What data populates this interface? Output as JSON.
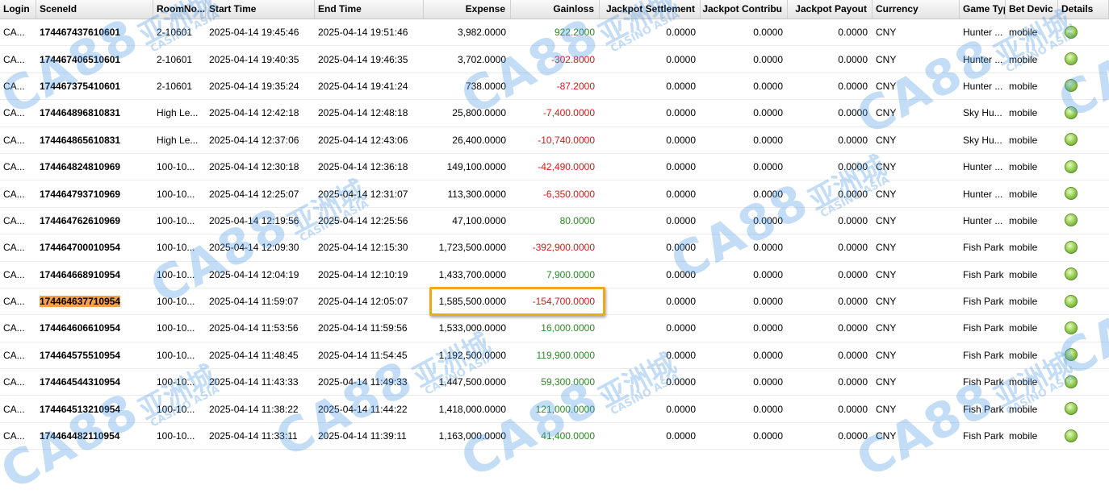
{
  "columns": [
    "Login",
    "SceneId",
    "RoomNo...",
    "Start Time",
    "End Time",
    "Expense",
    "Gainloss",
    "Jackpot Settlement",
    "Jackpot Contribu",
    "Jackpot Payout",
    "Currency",
    "Game Typ",
    "Bet Devic",
    "Details"
  ],
  "rows": [
    {
      "login": "CA...",
      "scene": "174467437610601",
      "room": "2-10601",
      "start": "2025-04-14 19:45:46",
      "end": "2025-04-14 19:51:46",
      "expense": "3,982.0000",
      "gainloss": "922.2000",
      "sign": "pos",
      "js": "0.0000",
      "jc": "0.0000",
      "jp": "0.0000",
      "currency": "CNY",
      "game": "Hunter ...",
      "device": "mobile"
    },
    {
      "login": "CA...",
      "scene": "174467406510601",
      "room": "2-10601",
      "start": "2025-04-14 19:40:35",
      "end": "2025-04-14 19:46:35",
      "expense": "3,702.0000",
      "gainloss": "-302.8000",
      "sign": "neg",
      "js": "0.0000",
      "jc": "0.0000",
      "jp": "0.0000",
      "currency": "CNY",
      "game": "Hunter ...",
      "device": "mobile"
    },
    {
      "login": "CA...",
      "scene": "174467375410601",
      "room": "2-10601",
      "start": "2025-04-14 19:35:24",
      "end": "2025-04-14 19:41:24",
      "expense": "738.0000",
      "gainloss": "-87.2000",
      "sign": "neg",
      "js": "0.0000",
      "jc": "0.0000",
      "jp": "0.0000",
      "currency": "CNY",
      "game": "Hunter ...",
      "device": "mobile"
    },
    {
      "login": "CA...",
      "scene": "174464896810831",
      "room": "High Le...",
      "start": "2025-04-14 12:42:18",
      "end": "2025-04-14 12:48:18",
      "expense": "25,800.0000",
      "gainloss": "-7,400.0000",
      "sign": "neg",
      "js": "0.0000",
      "jc": "0.0000",
      "jp": "0.0000",
      "currency": "CNY",
      "game": "Sky Hu...",
      "device": "mobile"
    },
    {
      "login": "CA...",
      "scene": "174464865610831",
      "room": "High Le...",
      "start": "2025-04-14 12:37:06",
      "end": "2025-04-14 12:43:06",
      "expense": "26,400.0000",
      "gainloss": "-10,740.0000",
      "sign": "neg",
      "js": "0.0000",
      "jc": "0.0000",
      "jp": "0.0000",
      "currency": "CNY",
      "game": "Sky Hu...",
      "device": "mobile"
    },
    {
      "login": "CA...",
      "scene": "174464824810969",
      "room": "100-10...",
      "start": "2025-04-14 12:30:18",
      "end": "2025-04-14 12:36:18",
      "expense": "149,100.0000",
      "gainloss": "-42,490.0000",
      "sign": "neg",
      "js": "0.0000",
      "jc": "0.0000",
      "jp": "0.0000",
      "currency": "CNY",
      "game": "Hunter ...",
      "device": "mobile"
    },
    {
      "login": "CA...",
      "scene": "174464793710969",
      "room": "100-10...",
      "start": "2025-04-14 12:25:07",
      "end": "2025-04-14 12:31:07",
      "expense": "113,300.0000",
      "gainloss": "-6,350.0000",
      "sign": "neg",
      "js": "0.0000",
      "jc": "0.0000",
      "jp": "0.0000",
      "currency": "CNY",
      "game": "Hunter ...",
      "device": "mobile"
    },
    {
      "login": "CA...",
      "scene": "174464762610969",
      "room": "100-10...",
      "start": "2025-04-14 12:19:56",
      "end": "2025-04-14 12:25:56",
      "expense": "47,100.0000",
      "gainloss": "80.0000",
      "sign": "pos",
      "js": "0.0000",
      "jc": "0.0000",
      "jp": "0.0000",
      "currency": "CNY",
      "game": "Hunter ...",
      "device": "mobile"
    },
    {
      "login": "CA...",
      "scene": "174464700010954",
      "room": "100-10...",
      "start": "2025-04-14 12:09:30",
      "end": "2025-04-14 12:15:30",
      "expense": "1,723,500.0000",
      "gainloss": "-392,900.0000",
      "sign": "neg",
      "js": "0.0000",
      "jc": "0.0000",
      "jp": "0.0000",
      "currency": "CNY",
      "game": "Fish Park",
      "device": "mobile"
    },
    {
      "login": "CA...",
      "scene": "174464668910954",
      "room": "100-10...",
      "start": "2025-04-14 12:04:19",
      "end": "2025-04-14 12:10:19",
      "expense": "1,433,700.0000",
      "gainloss": "7,900.0000",
      "sign": "pos",
      "js": "0.0000",
      "jc": "0.0000",
      "jp": "0.0000",
      "currency": "CNY",
      "game": "Fish Park",
      "device": "mobile"
    },
    {
      "login": "CA...",
      "scene": "174464637710954",
      "room": "100-10...",
      "start": "2025-04-14 11:59:07",
      "end": "2025-04-14 12:05:07",
      "expense": "1,585,500.0000",
      "gainloss": "-154,700.0000",
      "sign": "neg",
      "js": "0.0000",
      "jc": "0.0000",
      "jp": "0.0000",
      "currency": "CNY",
      "game": "Fish Park",
      "device": "mobile",
      "highlight": true
    },
    {
      "login": "CA...",
      "scene": "174464606610954",
      "room": "100-10...",
      "start": "2025-04-14 11:53:56",
      "end": "2025-04-14 11:59:56",
      "expense": "1,533,000.0000",
      "gainloss": "16,000.0000",
      "sign": "pos",
      "js": "0.0000",
      "jc": "0.0000",
      "jp": "0.0000",
      "currency": "CNY",
      "game": "Fish Park",
      "device": "mobile"
    },
    {
      "login": "CA...",
      "scene": "174464575510954",
      "room": "100-10...",
      "start": "2025-04-14 11:48:45",
      "end": "2025-04-14 11:54:45",
      "expense": "1,192,500.0000",
      "gainloss": "119,900.0000",
      "sign": "pos",
      "js": "0.0000",
      "jc": "0.0000",
      "jp": "0.0000",
      "currency": "CNY",
      "game": "Fish Park",
      "device": "mobile"
    },
    {
      "login": "CA...",
      "scene": "174464544310954",
      "room": "100-10...",
      "start": "2025-04-14 11:43:33",
      "end": "2025-04-14 11:49:33",
      "expense": "1,447,500.0000",
      "gainloss": "59,300.0000",
      "sign": "pos",
      "js": "0.0000",
      "jc": "0.0000",
      "jp": "0.0000",
      "currency": "CNY",
      "game": "Fish Park",
      "device": "mobile"
    },
    {
      "login": "CA...",
      "scene": "174464513210954",
      "room": "100-10...",
      "start": "2025-04-14 11:38:22",
      "end": "2025-04-14 11:44:22",
      "expense": "1,418,000.0000",
      "gainloss": "121,000.0000",
      "sign": "pos",
      "js": "0.0000",
      "jc": "0.0000",
      "jp": "0.0000",
      "currency": "CNY",
      "game": "Fish Park",
      "device": "mobile"
    },
    {
      "login": "CA...",
      "scene": "174464482110954",
      "room": "100-10...",
      "start": "2025-04-14 11:33:11",
      "end": "2025-04-14 11:39:11",
      "expense": "1,163,000.0000",
      "gainloss": "41,400.0000",
      "sign": "pos",
      "js": "0.0000",
      "jc": "0.0000",
      "jp": "0.0000",
      "currency": "CNY",
      "game": "Fish Park",
      "device": "mobile"
    }
  ],
  "watermark": {
    "brand": "CA88",
    "cn": "亚洲城",
    "sub": "CASINO ASIA"
  },
  "colors": {
    "positive": "#2a8a22",
    "negative": "#d81818",
    "highlight": "#f6a04a",
    "callout": "#f0a818"
  },
  "icons": {
    "details": "green-dot-icon"
  }
}
